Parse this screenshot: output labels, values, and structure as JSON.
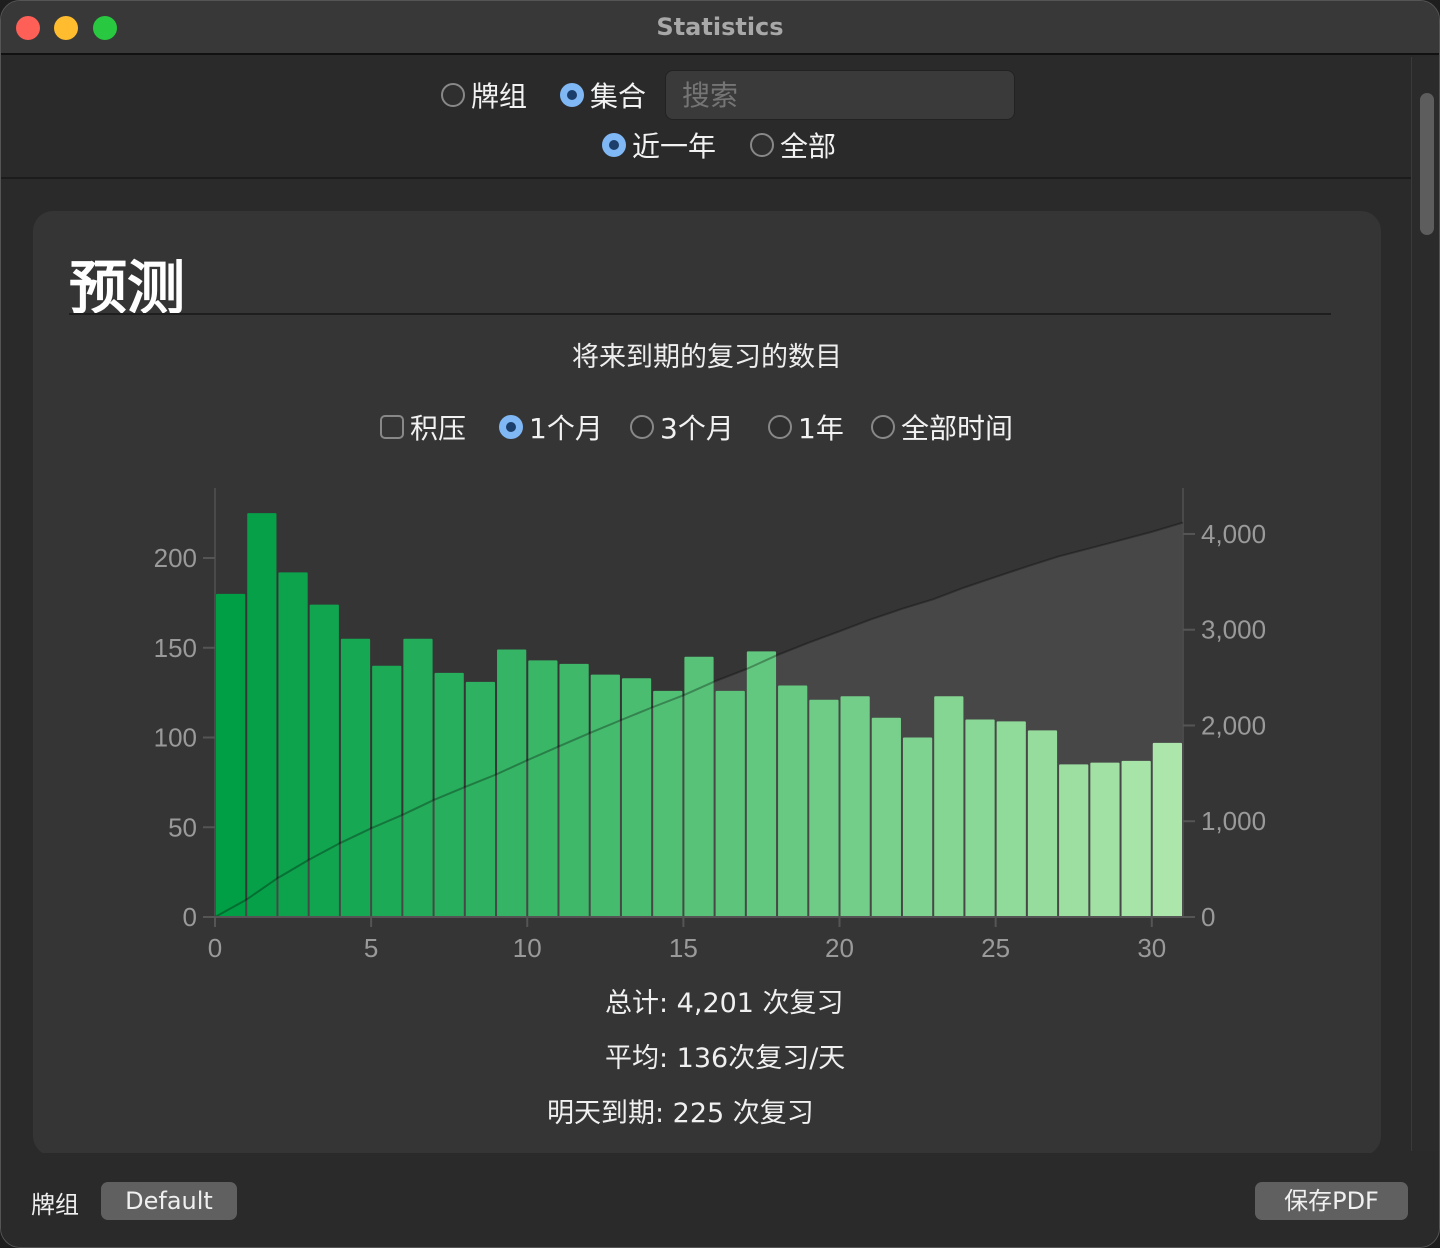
{
  "window": {
    "title": "Statistics",
    "colors": {
      "close": "#fe5f57",
      "minimize": "#febc2e",
      "zoom": "#28c840"
    }
  },
  "top": {
    "scope_options": [
      {
        "label": "牌组",
        "selected": false
      },
      {
        "label": "集合",
        "selected": true
      }
    ],
    "search_placeholder": "搜索",
    "range_options": [
      {
        "label": "近一年",
        "selected": true
      },
      {
        "label": "全部",
        "selected": false
      }
    ]
  },
  "section": {
    "title": "预测",
    "subtitle": "将来到期的复习的数目",
    "backlog_label": "积压",
    "backlog_checked": false,
    "period_options": [
      {
        "label": "1个月",
        "selected": true
      },
      {
        "label": "3个月",
        "selected": false
      },
      {
        "label": "1年",
        "selected": false
      },
      {
        "label": "全部时间",
        "selected": false
      }
    ]
  },
  "chart_data": {
    "type": "bar",
    "x": [
      0,
      1,
      2,
      3,
      4,
      5,
      6,
      7,
      8,
      9,
      10,
      11,
      12,
      13,
      14,
      15,
      16,
      17,
      18,
      19,
      20,
      21,
      22,
      23,
      24,
      25,
      26,
      27,
      28,
      29,
      30
    ],
    "values": [
      180,
      225,
      192,
      174,
      155,
      140,
      155,
      136,
      131,
      149,
      143,
      141,
      135,
      133,
      126,
      145,
      126,
      148,
      129,
      121,
      123,
      111,
      100,
      123,
      110,
      109,
      104,
      85,
      86,
      87,
      97
    ],
    "cumulative_series": "running total (right axis)",
    "xticks": [
      "0",
      "5",
      "10",
      "15",
      "20",
      "25",
      "30"
    ],
    "xtick_values": [
      0,
      5,
      10,
      15,
      20,
      25,
      30
    ],
    "yticks_left": [
      "0",
      "50",
      "100",
      "150",
      "200"
    ],
    "ytick_left_values": [
      0,
      50,
      100,
      150,
      200
    ],
    "yticks_right": [
      "0",
      "1,000",
      "2,000",
      "3,000",
      "4,000"
    ],
    "ytick_right_values": [
      0,
      1000,
      2000,
      3000,
      4000
    ],
    "ylim_left": [
      0,
      239
    ],
    "ylim_right": [
      0,
      4480
    ],
    "xlim": [
      0,
      31
    ],
    "bar_color_start": "#009e45",
    "bar_color_end": "#ade6ab",
    "area_color": "#474747"
  },
  "stats": {
    "total": "总计: 4,201 次复习",
    "average": "平均: 136次复习/天",
    "due_tomorrow": "明天到期: 225 次复习"
  },
  "bottom": {
    "deck_label": "牌组",
    "deck_button": "Default",
    "save_pdf": "保存PDF"
  }
}
